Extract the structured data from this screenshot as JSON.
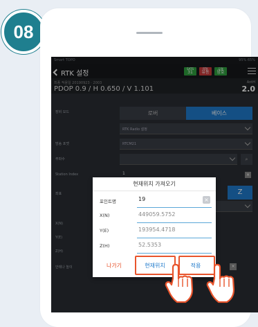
{
  "step": {
    "number": "08"
  },
  "status": {
    "app": "Smart TOPO",
    "battery1": "95%",
    "battery2": "65%"
  },
  "header": {
    "title": "RTK 설정",
    "badges": [
      {
        "top": "SATS",
        "value": "31",
        "color": "#2e9e3e"
      },
      {
        "top": "RTK",
        "value": "유동",
        "color": "#c73a3a"
      },
      {
        "top": "무결",
        "value": "양호",
        "color": "#2e9e3e"
      }
    ]
  },
  "info": {
    "small": "최종 적용일 20190923 · 2003",
    "pdop": "PDOP 0.9 / H 0.650 / V 1.101",
    "ant_label": "AntH",
    "ant_value": "2.0"
  },
  "form": {
    "mode_label": "장비 모드",
    "mode_options": [
      "로버",
      "베이스"
    ],
    "mode_selected": "베이스",
    "radio_value": "RTK Radio 설정",
    "format_label": "방송 포맷",
    "format_value": "RTCM21",
    "freq_label": "주파수",
    "station_label": "Station Index",
    "station_value": "1",
    "coord_label": "좌표",
    "x_label": "X(N)",
    "y_label": "Y(E)",
    "z_label": "Z(H)",
    "antenna_label": "안테나 높이"
  },
  "dialog": {
    "title": "현재위치 가져오기",
    "fields": [
      {
        "key": "포인트명",
        "value": "19"
      },
      {
        "key": "X(N)",
        "value": "449059.5752"
      },
      {
        "key": "Y(E)",
        "value": "193954.4718"
      },
      {
        "key": "Z(H)",
        "value": "52.5353"
      }
    ],
    "buttons": {
      "back": "나가기",
      "current": "현재위치",
      "apply": "적용"
    }
  }
}
